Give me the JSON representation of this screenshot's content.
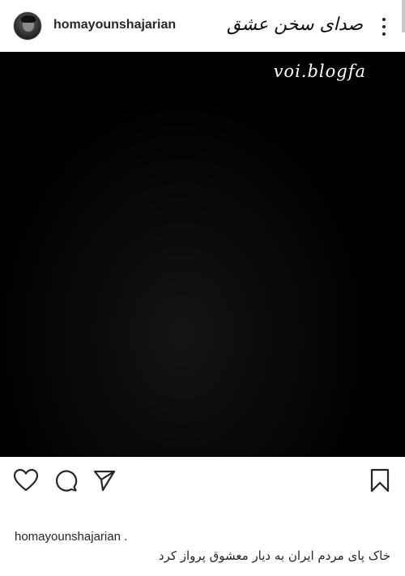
{
  "header": {
    "username": "homayounshajarian",
    "watermark": "صدای سخن عشق"
  },
  "photo": {
    "watermark": "voi.blogfa"
  },
  "icons": {
    "like": "heart-icon",
    "comment": "comment-icon",
    "share": "share-icon",
    "save": "bookmark-icon",
    "more": "more-options-icon"
  },
  "caption": {
    "username": "homayounshajarian .",
    "text": "خاک پای مردم ایران به دیار معشوق پرواز کرد"
  }
}
